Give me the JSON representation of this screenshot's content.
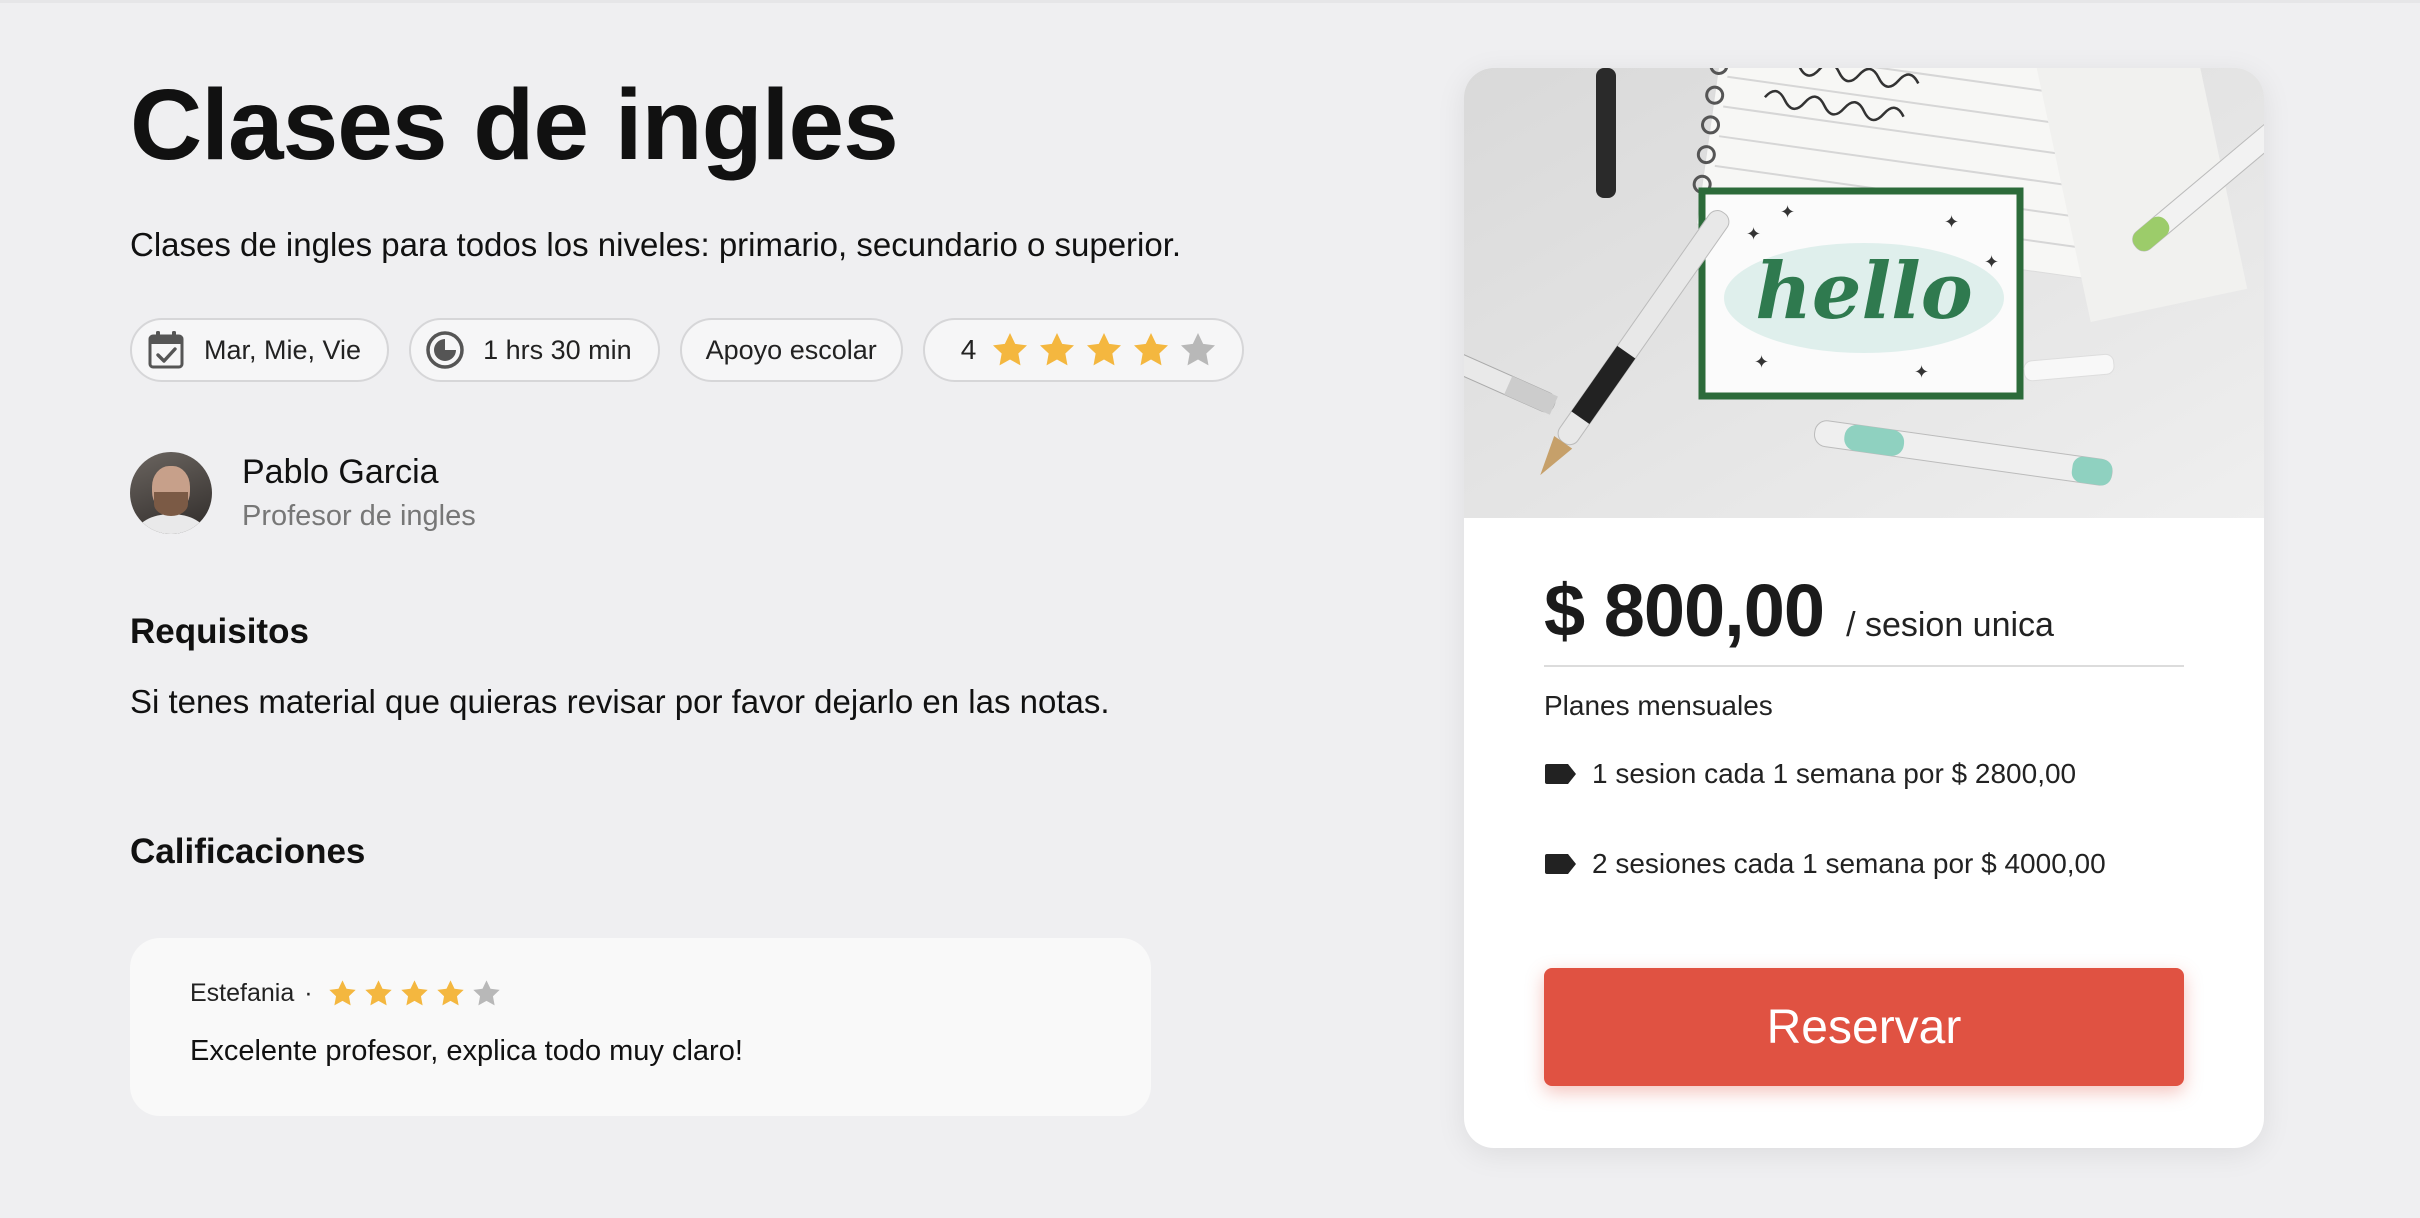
{
  "page": {
    "title": "Clases de ingles",
    "subtitle": "Clases de ingles para todos los niveles: primario, secundario o superior."
  },
  "chips": {
    "days": "Mar, Mie, Vie",
    "duration": "1 hrs 30 min",
    "category": "Apoyo escolar",
    "rating_value": "4",
    "rating_stars": 4,
    "rating_max": 5
  },
  "teacher": {
    "name": "Pablo Garcia",
    "role": "Profesor de ingles"
  },
  "requirements": {
    "heading": "Requisitos",
    "text": "Si tenes material que quieras revisar por favor dejarlo en las notas."
  },
  "ratings": {
    "heading": "Calificaciones",
    "reviews": [
      {
        "author": "Estefania",
        "separator": "·",
        "stars": 4,
        "max": 5,
        "comment": "Excelente profesor, explica todo muy claro!"
      }
    ]
  },
  "booking": {
    "image_text": "hello",
    "price": "$ 800,00",
    "price_unit": "/ sesion unica",
    "plans_heading": "Planes mensuales",
    "plans": [
      "1 sesion cada 1 semana por $ 2800,00",
      "2 sesiones cada 1 semana por $ 4000,00"
    ],
    "reserve_label": "Reservar"
  },
  "colors": {
    "accent": "#e05242",
    "star_filled": "#f4b73f",
    "star_empty": "#b8b8b8",
    "background": "#efeff1"
  },
  "icons": {
    "days": "calendar-check-icon",
    "duration": "clock-icon",
    "plan": "tag-icon",
    "rating": "star-icon"
  }
}
